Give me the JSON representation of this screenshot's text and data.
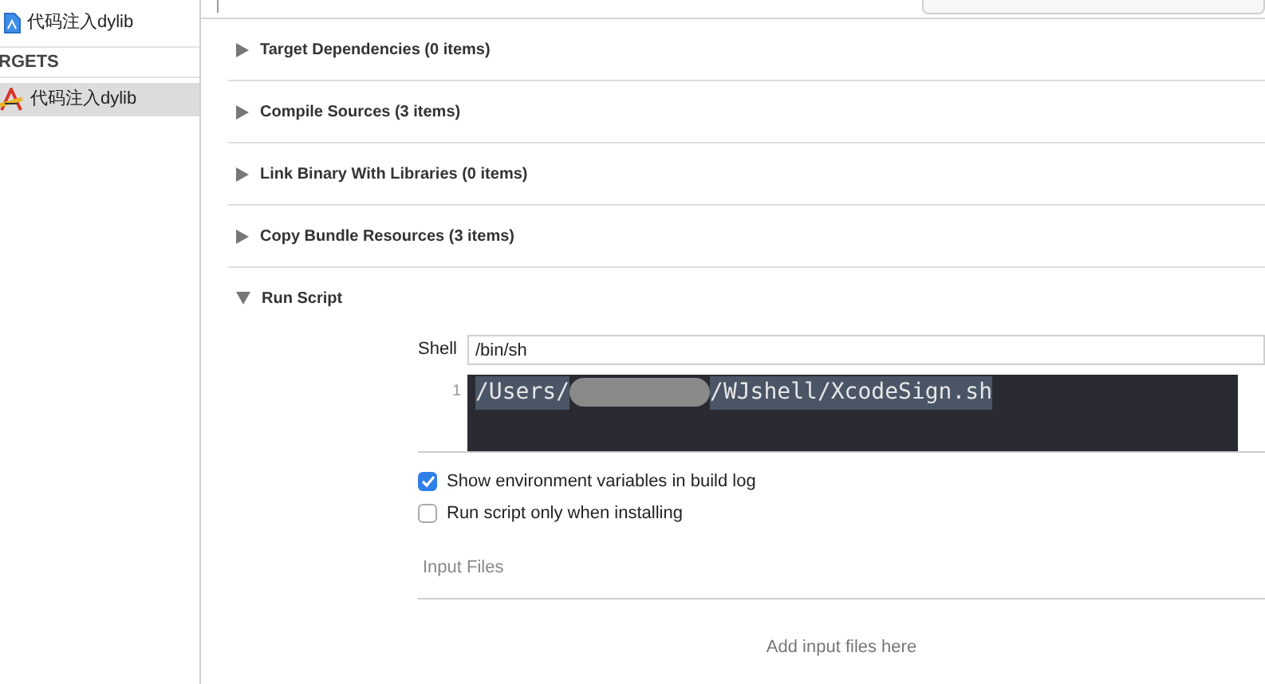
{
  "sidebar": {
    "project": {
      "label": "代码注入dylib"
    },
    "section_heading": "RGETS",
    "targets": [
      {
        "label": "代码注入dylib",
        "selected": true
      }
    ]
  },
  "phases": [
    {
      "title": "Target Dependencies (0 items)",
      "expanded": false
    },
    {
      "title": "Compile Sources (3 items)",
      "expanded": false
    },
    {
      "title": "Link Binary With Libraries (0 items)",
      "expanded": false
    },
    {
      "title": "Copy Bundle Resources (3 items)",
      "expanded": false
    },
    {
      "title": "Run Script",
      "expanded": true
    }
  ],
  "run_script": {
    "shell_label": "Shell",
    "shell_value": "/bin/sh",
    "line_number": "1",
    "code_start": "/Users/",
    "code_end": "/WJshell/XcodeSign.sh",
    "options": [
      {
        "label": "Show environment variables in build log",
        "checked": true
      },
      {
        "label": "Run script only when installing",
        "checked": false
      }
    ],
    "input_files_heading": "Input Files",
    "input_files_hint": "Add input files here"
  }
}
